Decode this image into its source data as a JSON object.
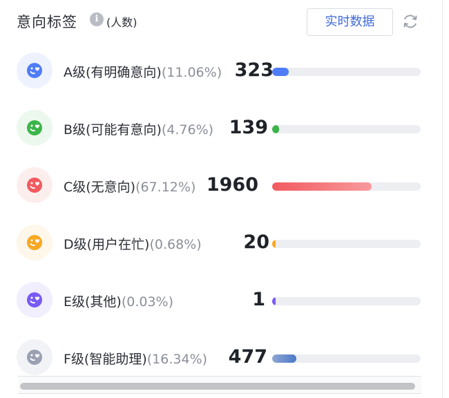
{
  "header": {
    "title": "意向标签",
    "info_icon": "info-icon",
    "subtitle": "(人数)",
    "realtime_button": "实时数据",
    "refresh_icon": "refresh-icon"
  },
  "rows": [
    {
      "label": "A级(有明确意向)",
      "pct": "(11.06%)",
      "count": "323",
      "fraction": 0.11,
      "color": "#4f7cf7",
      "bg": "#eef2fe",
      "fill_color": "#4f7cf7",
      "icon": "smile-heart-icon"
    },
    {
      "label": "B级(可能有意向)",
      "pct": "(4.76%)",
      "count": "139",
      "fraction": 0.047,
      "color": "#3bb54a",
      "bg": "#ecf8ee",
      "fill_color": "#3bb54a",
      "icon": "smile-heart-icon"
    },
    {
      "label": "C级(无意向)",
      "pct": "(67.12%)",
      "count": "1960",
      "fraction": 0.671,
      "color": "#f15a5f",
      "bg": "#fdeeee",
      "fill_color": "#f15a5f",
      "icon": "smile-heart-icon"
    },
    {
      "label": "D级(用户在忙)",
      "pct": "(0.68%)",
      "count": "20",
      "fraction": 0.007,
      "color": "#f7a823",
      "bg": "#fef7ea",
      "fill_color": "#f7a823",
      "icon": "smile-heart-icon"
    },
    {
      "label": "E级(其他)",
      "pct": "(0.03%)",
      "count": "1",
      "fraction": 0.0003,
      "color": "#7a5af5",
      "bg": "#f1eefe",
      "fill_color": "#7a5af5",
      "icon": "smile-heart-icon"
    },
    {
      "label": "F级(智能助理)",
      "pct": "(16.34%)",
      "count": "477",
      "fraction": 0.163,
      "color": "#9aa1b2",
      "bg": "#f2f3f6",
      "fill_color": "#4b78c8",
      "icon": "smile-heart-icon"
    }
  ]
}
